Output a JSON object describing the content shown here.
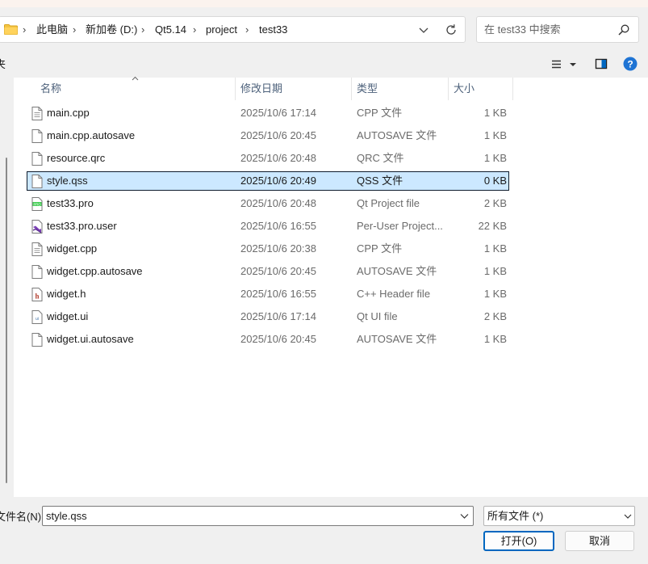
{
  "address": {
    "crumbs": [
      "此电脑",
      "新加卷 (D:)",
      "Qt5.14",
      "project",
      "test33"
    ]
  },
  "search": {
    "placeholder": "在 test33 中搜索"
  },
  "toolbar": {
    "left_label": "夹"
  },
  "columns": {
    "name": "名称",
    "date": "修改日期",
    "type": "类型",
    "size": "大小"
  },
  "files": [
    {
      "name": "main.cpp",
      "date": "2025/10/6 17:14",
      "type": "CPP 文件",
      "size": "1 KB",
      "icon": "text-file-icon"
    },
    {
      "name": "main.cpp.autosave",
      "date": "2025/10/6 20:45",
      "type": "AUTOSAVE 文件",
      "size": "1 KB",
      "icon": "blank-file-icon"
    },
    {
      "name": "resource.qrc",
      "date": "2025/10/6 20:48",
      "type": "QRC 文件",
      "size": "1 KB",
      "icon": "blank-file-icon"
    },
    {
      "name": "style.qss",
      "date": "2025/10/6 20:49",
      "type": "QSS 文件",
      "size": "0 KB",
      "icon": "blank-file-icon",
      "selected": true
    },
    {
      "name": "test33.pro",
      "date": "2025/10/6 20:48",
      "type": "Qt Project file",
      "size": "2 KB",
      "icon": "qt-pro-file-icon"
    },
    {
      "name": "test33.pro.user",
      "date": "2025/10/6 16:55",
      "type": "Per-User Project...",
      "size": "22 KB",
      "icon": "visual-studio-file-icon"
    },
    {
      "name": "widget.cpp",
      "date": "2025/10/6 20:38",
      "type": "CPP 文件",
      "size": "1 KB",
      "icon": "text-file-icon"
    },
    {
      "name": "widget.cpp.autosave",
      "date": "2025/10/6 20:45",
      "type": "AUTOSAVE 文件",
      "size": "1 KB",
      "icon": "blank-file-icon"
    },
    {
      "name": "widget.h",
      "date": "2025/10/6 16:55",
      "type": "C++ Header file",
      "size": "1 KB",
      "icon": "header-file-icon"
    },
    {
      "name": "widget.ui",
      "date": "2025/10/6 17:14",
      "type": "Qt UI file",
      "size": "2 KB",
      "icon": "qt-ui-file-icon"
    },
    {
      "name": "widget.ui.autosave",
      "date": "2025/10/6 20:45",
      "type": "AUTOSAVE 文件",
      "size": "1 KB",
      "icon": "blank-file-icon"
    }
  ],
  "bottom": {
    "filename_label": "文件名(N):",
    "filename_value": "style.qss",
    "filter_value": "所有文件 (*)",
    "open_label": "打开(O)",
    "cancel_label": "取消"
  },
  "colors": {
    "accent": "#0067c0",
    "selection": "#cce8ff",
    "header_text": "#4c607a"
  }
}
